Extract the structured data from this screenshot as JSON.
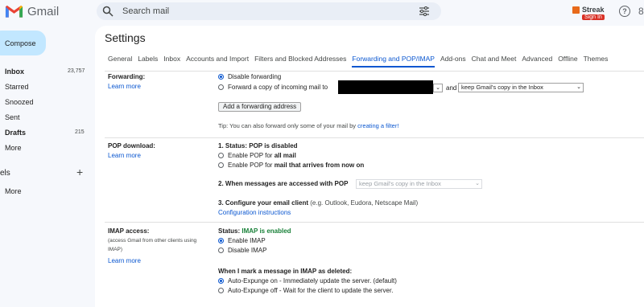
{
  "app": {
    "name": "Gmail"
  },
  "search": {
    "placeholder": "Search mail"
  },
  "streak": {
    "label": "Streak",
    "badge": "Sign In"
  },
  "help": {
    "glyph": "?"
  },
  "gear_partial": "8",
  "colors": {
    "accent": "#0b57d0",
    "compose_bg": "#c2e7ff",
    "enabled_green": "#188038",
    "gmail_red": "#ea4335"
  },
  "sidebar": {
    "compose": "Compose",
    "items": [
      {
        "label": "Inbox",
        "count": "23,757",
        "bold": true
      },
      {
        "label": "Starred",
        "count": ""
      },
      {
        "label": "Snoozed",
        "count": ""
      },
      {
        "label": "Sent",
        "count": ""
      },
      {
        "label": "Drafts",
        "count": "215",
        "bold": true
      },
      {
        "label": "More",
        "count": ""
      }
    ],
    "labels_heading": "els",
    "labels_more": "More"
  },
  "settings": {
    "title": "Settings",
    "tabs": [
      "General",
      "Labels",
      "Inbox",
      "Accounts and Import",
      "Filters and Blocked Addresses",
      "Forwarding and POP/IMAP",
      "Add-ons",
      "Chat and Meet",
      "Advanced",
      "Offline",
      "Themes"
    ],
    "active_tab": "Forwarding and POP/IMAP"
  },
  "forwarding": {
    "label": "Forwarding:",
    "learn_more": "Learn more",
    "disable": "Disable forwarding",
    "forward_copy": "Forward a copy of incoming mail to",
    "and": "and",
    "action_select": "keep Gmail's copy in the Inbox",
    "add_button": "Add a forwarding address",
    "tip_prefix": "Tip: You can also forward only some of your mail by",
    "tip_link": "creating a filter!"
  },
  "pop": {
    "label": "POP download:",
    "learn_more": "Learn more",
    "status_prefix": "1. Status:",
    "status": "POP is disabled",
    "opt1_prefix": "Enable POP for",
    "opt1_bold": "all mail",
    "opt2_prefix": "Enable POP for",
    "opt2_bold": "mail that arrives from now on",
    "step2": "2. When messages are accessed with POP",
    "step2_select": "keep Gmail's copy in the Inbox",
    "step3": "3. Configure your email client",
    "step3_note": "(e.g. Outlook, Eudora, Netscape Mail)",
    "config_link": "Configuration instructions"
  },
  "imap": {
    "label": "IMAP access:",
    "note": "(access Gmail from other clients using IMAP)",
    "learn_more": "Learn more",
    "status_prefix": "Status:",
    "status": "IMAP is enabled",
    "enable": "Enable IMAP",
    "disable": "Disable IMAP",
    "deleted_heading": "When I mark a message in IMAP as deleted:",
    "expunge_on": "Auto-Expunge on - Immediately update the server. (default)",
    "expunge_off": "Auto-Expunge off - Wait for the client to update the server."
  }
}
